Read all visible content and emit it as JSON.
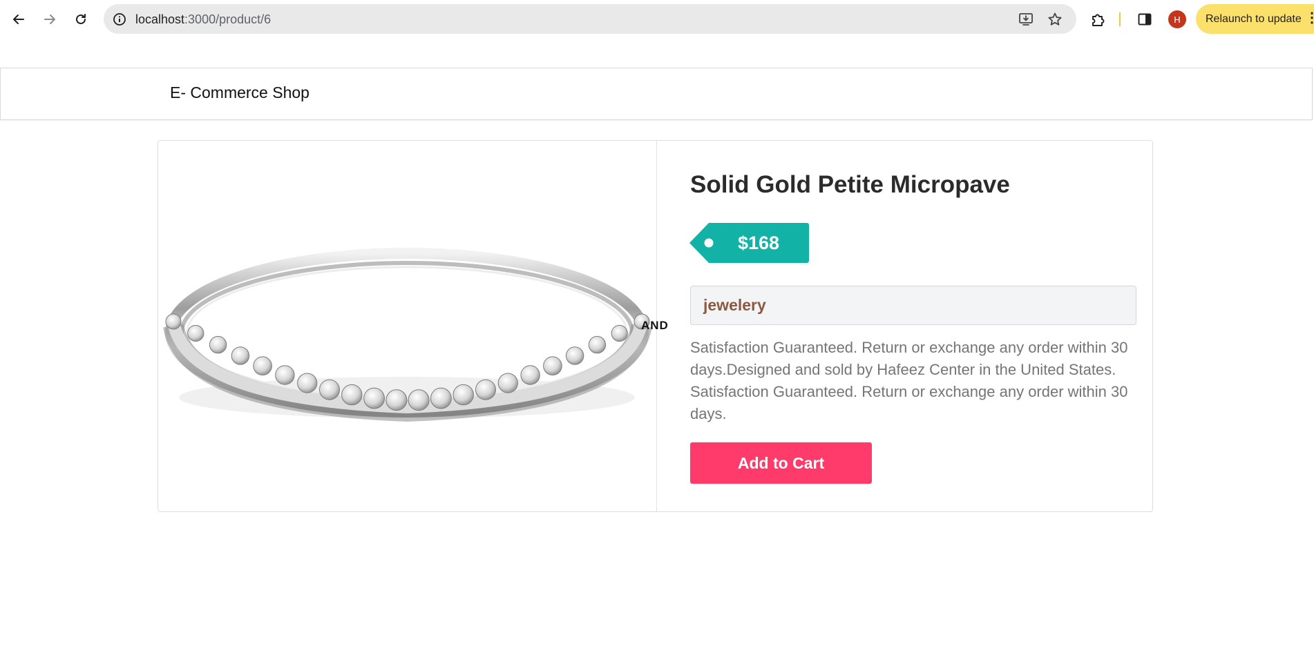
{
  "browser": {
    "url_host": "localhost",
    "url_path": ":3000/product/6",
    "profile_initial": "H",
    "relaunch_label": "Relaunch to update",
    "menu_glyph": "⋮"
  },
  "header": {
    "brand": "E- Commerce Shop"
  },
  "product": {
    "title": "Solid Gold Petite Micropave",
    "price": "$168",
    "category": "jewelery",
    "description": "Satisfaction Guaranteed. Return or exchange any order within 30 days.Designed and sold by Hafeez Center in the United States. Satisfaction Guaranteed. Return or exchange any order within 30 days.",
    "image_fragment_text": "AND",
    "add_to_cart_label": "Add to Cart"
  },
  "colors": {
    "price_tag": "#12b3a6",
    "category_text": "#8b5840",
    "cart_button": "#ff3b6b",
    "relaunch_bg": "#fbe06b",
    "avatar_bg": "#c5351d"
  },
  "icons": {
    "back": "arrow-left-icon",
    "forward": "arrow-right-icon",
    "reload": "reload-icon",
    "site_info": "info-icon",
    "install": "install-app-icon",
    "bookmark": "star-icon",
    "extensions": "puzzle-icon",
    "side_panel": "side-panel-icon"
  }
}
